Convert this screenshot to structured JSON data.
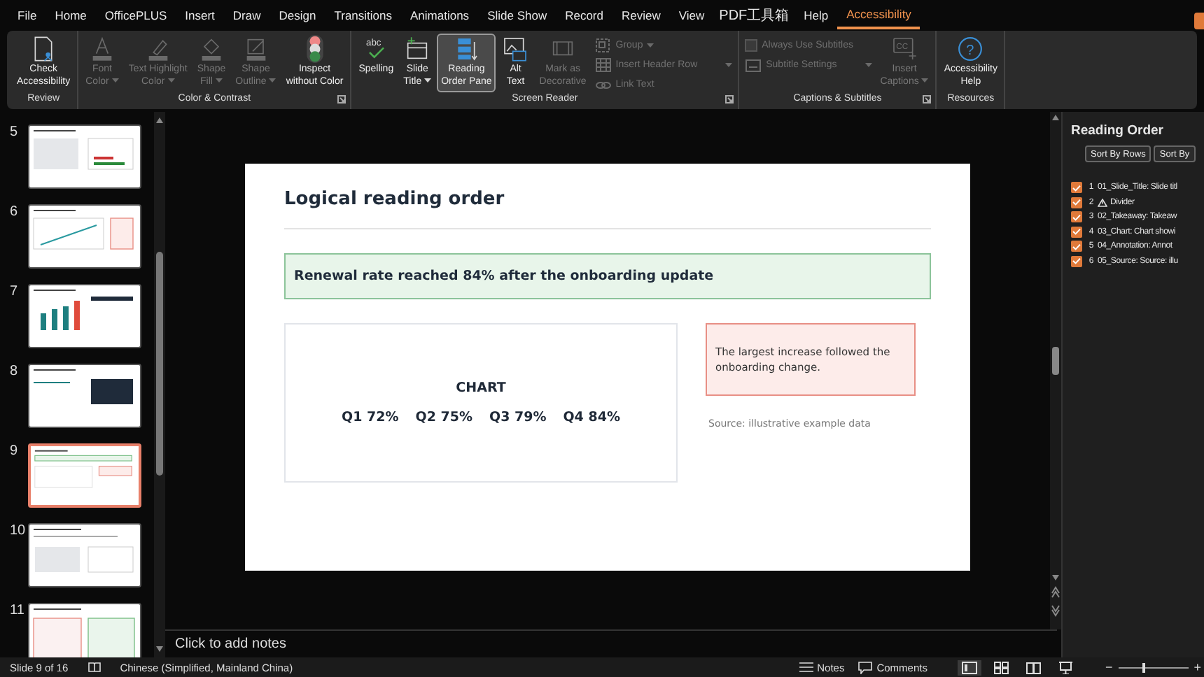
{
  "menu_tabs": [
    {
      "label": "File",
      "selected": false
    },
    {
      "label": "Home",
      "selected": false
    },
    {
      "label": "OfficePLUS",
      "selected": false
    },
    {
      "label": "Insert",
      "selected": false
    },
    {
      "label": "Draw",
      "selected": false
    },
    {
      "label": "Design",
      "selected": false
    },
    {
      "label": "Transitions",
      "selected": false
    },
    {
      "label": "Animations",
      "selected": false
    },
    {
      "label": "Slide Show",
      "selected": false
    },
    {
      "label": "Record",
      "selected": false
    },
    {
      "label": "Review",
      "selected": false
    },
    {
      "label": "View",
      "selected": false
    },
    {
      "label": "PDF工具箱",
      "selected": false
    },
    {
      "label": "Help",
      "selected": false
    },
    {
      "label": "Accessibility",
      "selected": true
    }
  ],
  "ribbon": {
    "groups": [
      {
        "label": "Review",
        "launcher": false,
        "items": [
          {
            "kind": "large",
            "lines": [
              "Check",
              "Accessibility"
            ],
            "disabled": false,
            "dropdown": false,
            "pressed": false
          }
        ]
      },
      {
        "label": "Color & Contrast",
        "launcher": true,
        "items": [
          {
            "kind": "large",
            "lines": [
              "Font",
              "Color"
            ],
            "disabled": true,
            "dropdown": true,
            "pressed": false
          },
          {
            "kind": "large",
            "lines": [
              "Text Highlight",
              "Color"
            ],
            "disabled": true,
            "dropdown": true,
            "pressed": false
          },
          {
            "kind": "large",
            "lines": [
              "Shape",
              "Fill"
            ],
            "disabled": true,
            "dropdown": true,
            "pressed": false
          },
          {
            "kind": "large",
            "lines": [
              "Shape",
              "Outline"
            ],
            "disabled": true,
            "dropdown": true,
            "pressed": false
          },
          {
            "kind": "large",
            "lines": [
              "Inspect",
              "without Color"
            ],
            "disabled": false,
            "dropdown": false,
            "pressed": false
          }
        ]
      },
      {
        "label": "Screen Reader",
        "launcher": true,
        "items": [
          {
            "kind": "large",
            "lines": [
              "Spelling"
            ],
            "glyph": "abc",
            "disabled": false,
            "dropdown": false,
            "pressed": false
          },
          {
            "kind": "large",
            "lines": [
              "Slide",
              "Title"
            ],
            "disabled": false,
            "dropdown": true,
            "pressed": false
          },
          {
            "kind": "large",
            "lines": [
              "Reading",
              "Order Pane"
            ],
            "disabled": false,
            "dropdown": false,
            "pressed": true
          },
          {
            "kind": "large",
            "lines": [
              "Alt",
              "Text"
            ],
            "disabled": false,
            "dropdown": false,
            "pressed": false
          },
          {
            "kind": "large",
            "lines": [
              "Mark as",
              "Decorative"
            ],
            "disabled": true,
            "dropdown": false,
            "pressed": false
          },
          {
            "kind": "small",
            "lines": [
              "Group"
            ],
            "disabled": true,
            "dropdown": true
          },
          {
            "kind": "small",
            "lines": [
              "Insert Header Row"
            ],
            "disabled": true,
            "dropdown": true
          },
          {
            "kind": "small",
            "lines": [
              "Link Text"
            ],
            "disabled": true,
            "dropdown": false
          }
        ]
      },
      {
        "label": "Captions & Subtitles",
        "launcher": true,
        "items": [
          {
            "kind": "checkbox",
            "lines": [
              "Always Use Subtitles"
            ],
            "disabled": true,
            "checked": false
          },
          {
            "kind": "small",
            "lines": [
              "Subtitle Settings"
            ],
            "disabled": true,
            "dropdown": true
          },
          {
            "kind": "large",
            "lines": [
              "Insert",
              "Captions"
            ],
            "glyph": "CC",
            "disabled": true,
            "dropdown": true,
            "pressed": false
          }
        ]
      },
      {
        "label": "Resources",
        "launcher": false,
        "items": [
          {
            "kind": "large",
            "lines": [
              "Accessibility",
              "Help"
            ],
            "glyph": "?",
            "disabled": false,
            "dropdown": false,
            "pressed": false
          }
        ]
      }
    ]
  },
  "slides": [
    {
      "number": "5",
      "selected": false
    },
    {
      "number": "6",
      "selected": false
    },
    {
      "number": "7",
      "selected": false
    },
    {
      "number": "8",
      "selected": false
    },
    {
      "number": "9",
      "selected": true
    },
    {
      "number": "10",
      "selected": false
    },
    {
      "number": "11",
      "selected": false
    }
  ],
  "slide": {
    "title": "Logical reading order",
    "takeaway": "Renewal rate reached 84% after the onboarding update",
    "chart_heading": "CHART",
    "chart_values": [
      "Q1 72%",
      "Q2 75%",
      "Q3 79%",
      "Q4 84%"
    ],
    "annotation": "The largest increase followed the onboarding change.",
    "source": "Source: illustrative example data"
  },
  "notes": {
    "placeholder": "Click to add notes"
  },
  "reading_order": {
    "title": "Reading Order",
    "sort_buttons": [
      "Sort By Rows",
      "Sort By"
    ],
    "items": [
      {
        "number": "1",
        "label": "01_Slide_Title: Slide titl",
        "checked": true,
        "warning": false
      },
      {
        "number": "2",
        "label": "Divider",
        "checked": true,
        "warning": true
      },
      {
        "number": "3",
        "label": "02_Takeaway: Takeaw",
        "checked": true,
        "warning": false
      },
      {
        "number": "4",
        "label": "03_Chart: Chart showi",
        "checked": true,
        "warning": false
      },
      {
        "number": "5",
        "label": "04_Annotation: Annot",
        "checked": true,
        "warning": false
      },
      {
        "number": "6",
        "label": "05_Source: Source: illu",
        "checked": true,
        "warning": false
      }
    ]
  },
  "status_bar": {
    "slide_info": "Slide 9 of 16",
    "language": "Chinese (Simplified, Mainland China)",
    "notes": "Notes",
    "comments": "Comments",
    "views": [
      {
        "selected": true
      },
      {
        "selected": false
      },
      {
        "selected": false
      },
      {
        "selected": false
      }
    ],
    "zoom": {
      "minus": "−",
      "plus": "+",
      "level": 0.35
    }
  }
}
